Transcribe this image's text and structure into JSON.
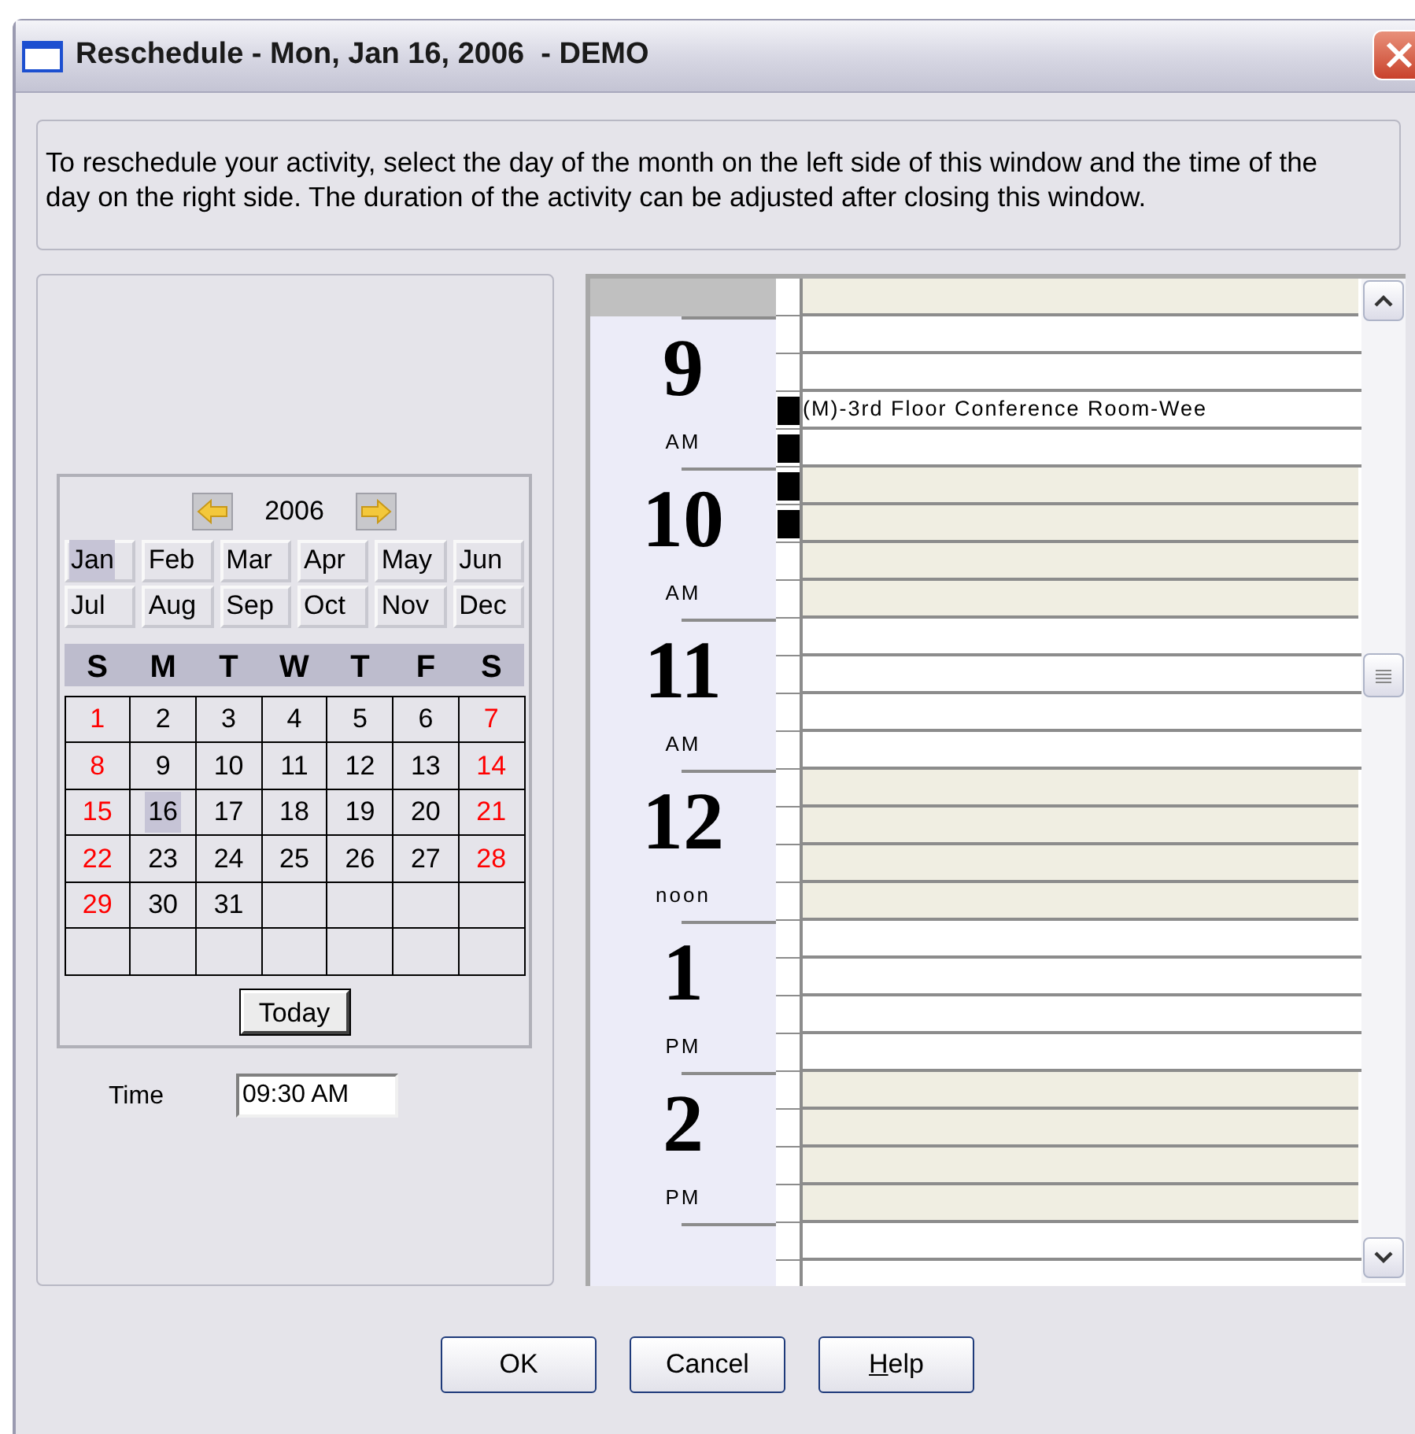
{
  "window": {
    "title": "Reschedule - Mon, Jan 16, 2006  - DEMO"
  },
  "instructions": "To reschedule your activity, select the day of the month on the left side of this window and the time of the day on the right side. The duration of the activity can be adjusted after closing this window.",
  "calendar": {
    "year": "2006",
    "months": [
      {
        "label": "Jan",
        "selected": true
      },
      {
        "label": "Feb",
        "selected": false
      },
      {
        "label": "Mar",
        "selected": false
      },
      {
        "label": "Apr",
        "selected": false
      },
      {
        "label": "May",
        "selected": false
      },
      {
        "label": "Jun",
        "selected": false
      },
      {
        "label": "Jul",
        "selected": false
      },
      {
        "label": "Aug",
        "selected": false
      },
      {
        "label": "Sep",
        "selected": false
      },
      {
        "label": "Oct",
        "selected": false
      },
      {
        "label": "Nov",
        "selected": false
      },
      {
        "label": "Dec",
        "selected": false
      }
    ],
    "weekdays": [
      "S",
      "M",
      "T",
      "W",
      "T",
      "F",
      "S"
    ],
    "days": [
      {
        "label": "1",
        "weekend": true,
        "selected": false
      },
      {
        "label": "2",
        "weekend": false,
        "selected": false
      },
      {
        "label": "3",
        "weekend": false,
        "selected": false
      },
      {
        "label": "4",
        "weekend": false,
        "selected": false
      },
      {
        "label": "5",
        "weekend": false,
        "selected": false
      },
      {
        "label": "6",
        "weekend": false,
        "selected": false
      },
      {
        "label": "7",
        "weekend": true,
        "selected": false
      },
      {
        "label": "8",
        "weekend": true,
        "selected": false
      },
      {
        "label": "9",
        "weekend": false,
        "selected": false
      },
      {
        "label": "10",
        "weekend": false,
        "selected": false
      },
      {
        "label": "11",
        "weekend": false,
        "selected": false
      },
      {
        "label": "12",
        "weekend": false,
        "selected": false
      },
      {
        "label": "13",
        "weekend": false,
        "selected": false
      },
      {
        "label": "14",
        "weekend": true,
        "selected": false
      },
      {
        "label": "15",
        "weekend": true,
        "selected": false
      },
      {
        "label": "16",
        "weekend": false,
        "selected": true
      },
      {
        "label": "17",
        "weekend": false,
        "selected": false
      },
      {
        "label": "18",
        "weekend": false,
        "selected": false
      },
      {
        "label": "19",
        "weekend": false,
        "selected": false
      },
      {
        "label": "20",
        "weekend": false,
        "selected": false
      },
      {
        "label": "21",
        "weekend": true,
        "selected": false
      },
      {
        "label": "22",
        "weekend": true,
        "selected": false
      },
      {
        "label": "23",
        "weekend": false,
        "selected": false
      },
      {
        "label": "24",
        "weekend": false,
        "selected": false
      },
      {
        "label": "25",
        "weekend": false,
        "selected": false
      },
      {
        "label": "26",
        "weekend": false,
        "selected": false
      },
      {
        "label": "27",
        "weekend": false,
        "selected": false
      },
      {
        "label": "28",
        "weekend": true,
        "selected": false
      },
      {
        "label": "29",
        "weekend": true,
        "selected": false
      },
      {
        "label": "30",
        "weekend": false,
        "selected": false
      },
      {
        "label": "31",
        "weekend": false,
        "selected": false
      }
    ],
    "today_button": "Today"
  },
  "time": {
    "label": "Time",
    "value": "09:30 AM"
  },
  "schedule": {
    "leading_slot": {
      "shaded": true,
      "booked": false
    },
    "hours": [
      {
        "number": "9",
        "suffix": "AM",
        "shaded": false,
        "slots": [
          {
            "booked": false
          },
          {
            "booked": false
          },
          {
            "booked": true,
            "event": "(M)-3rd Floor Conference Room-Wee"
          },
          {
            "booked": true
          }
        ]
      },
      {
        "number": "10",
        "suffix": "AM",
        "shaded": true,
        "slots": [
          {
            "booked": true
          },
          {
            "booked": true
          },
          {
            "booked": false
          },
          {
            "booked": false
          }
        ]
      },
      {
        "number": "11",
        "suffix": "AM",
        "shaded": false,
        "slots": [
          {
            "booked": false
          },
          {
            "booked": false
          },
          {
            "booked": false
          },
          {
            "booked": false
          }
        ]
      },
      {
        "number": "12",
        "suffix": "noon",
        "shaded": true,
        "slots": [
          {
            "booked": false
          },
          {
            "booked": false
          },
          {
            "booked": false
          },
          {
            "booked": false
          }
        ]
      },
      {
        "number": "1",
        "suffix": "PM",
        "shaded": false,
        "slots": [
          {
            "booked": false
          },
          {
            "booked": false
          },
          {
            "booked": false
          },
          {
            "booked": false
          }
        ]
      },
      {
        "number": "2",
        "suffix": "PM",
        "shaded": true,
        "slots": [
          {
            "booked": false
          },
          {
            "booked": false
          },
          {
            "booked": false
          },
          {
            "booked": false
          }
        ]
      },
      {
        "shaded": false,
        "slots": [
          {
            "booked": false
          }
        ]
      }
    ]
  },
  "buttons": [
    {
      "label": "OK",
      "mnemonic": false
    },
    {
      "label": "Cancel",
      "mnemonic": false
    },
    {
      "label": "Help",
      "mnemonic": true
    }
  ]
}
